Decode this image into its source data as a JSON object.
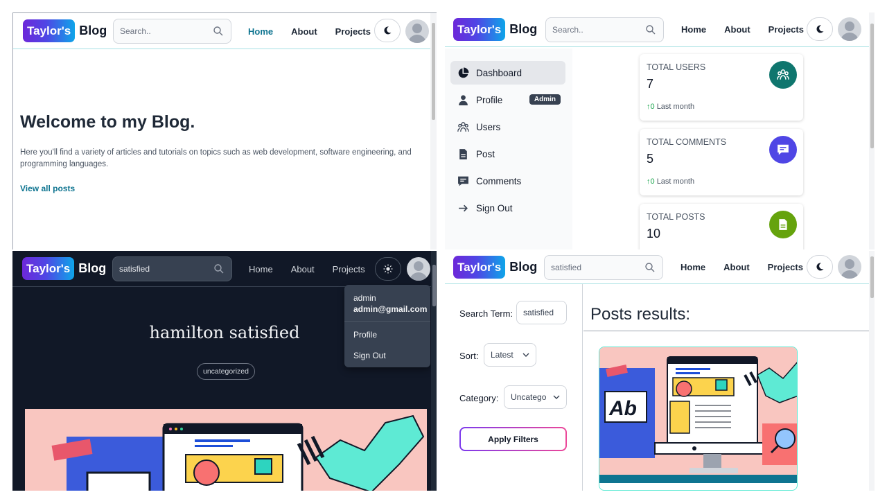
{
  "brand": {
    "pill": "Taylor's",
    "word": "Blog"
  },
  "nav_links": {
    "home": "Home",
    "about": "About",
    "projects": "Projects"
  },
  "search": {
    "placeholder": "Search..",
    "query": "satisfied"
  },
  "home": {
    "title": "Welcome to my Blog.",
    "description": "Here you'll find a variety of articles and tutorials on topics such as web development, software engineering, and programming languages.",
    "link": "View all posts"
  },
  "dashboard": {
    "sidebar": [
      {
        "label": "Dashboard",
        "icon": "pie-chart-icon"
      },
      {
        "label": "Profile",
        "icon": "user-icon",
        "badge": "Admin"
      },
      {
        "label": "Users",
        "icon": "users-icon"
      },
      {
        "label": "Post",
        "icon": "document-icon"
      },
      {
        "label": "Comments",
        "icon": "comment-icon"
      },
      {
        "label": "Sign Out",
        "icon": "arrow-right-icon"
      }
    ],
    "cards": [
      {
        "label": "TOTAL USERS",
        "value": "7",
        "trend": "0",
        "period": "Last month",
        "color": "#0f766e",
        "icon": "users-icon"
      },
      {
        "label": "TOTAL COMMENTS",
        "value": "5",
        "trend": "0",
        "period": "Last month",
        "color": "#4f46e5",
        "icon": "comment-icon"
      },
      {
        "label": "TOTAL POSTS",
        "value": "10",
        "color": "#65a30d",
        "icon": "document-icon"
      }
    ]
  },
  "post": {
    "title": "hamilton satisfied",
    "category": "uncategorized",
    "menu": {
      "username": "admin",
      "email": "admin@gmail.com",
      "profile": "Profile",
      "signout": "Sign Out"
    }
  },
  "search_page": {
    "term_label": "Search Term:",
    "term_value": "satisfied",
    "sort_label": "Sort:",
    "sort_value": "Latest",
    "category_label": "Category:",
    "category_value": "Uncatego",
    "apply": "Apply Filters",
    "results_title": "Posts results:"
  },
  "colors": {
    "accent": "#0e7490",
    "brand_from": "#6d28d9",
    "brand_to": "#0ea5e9"
  }
}
